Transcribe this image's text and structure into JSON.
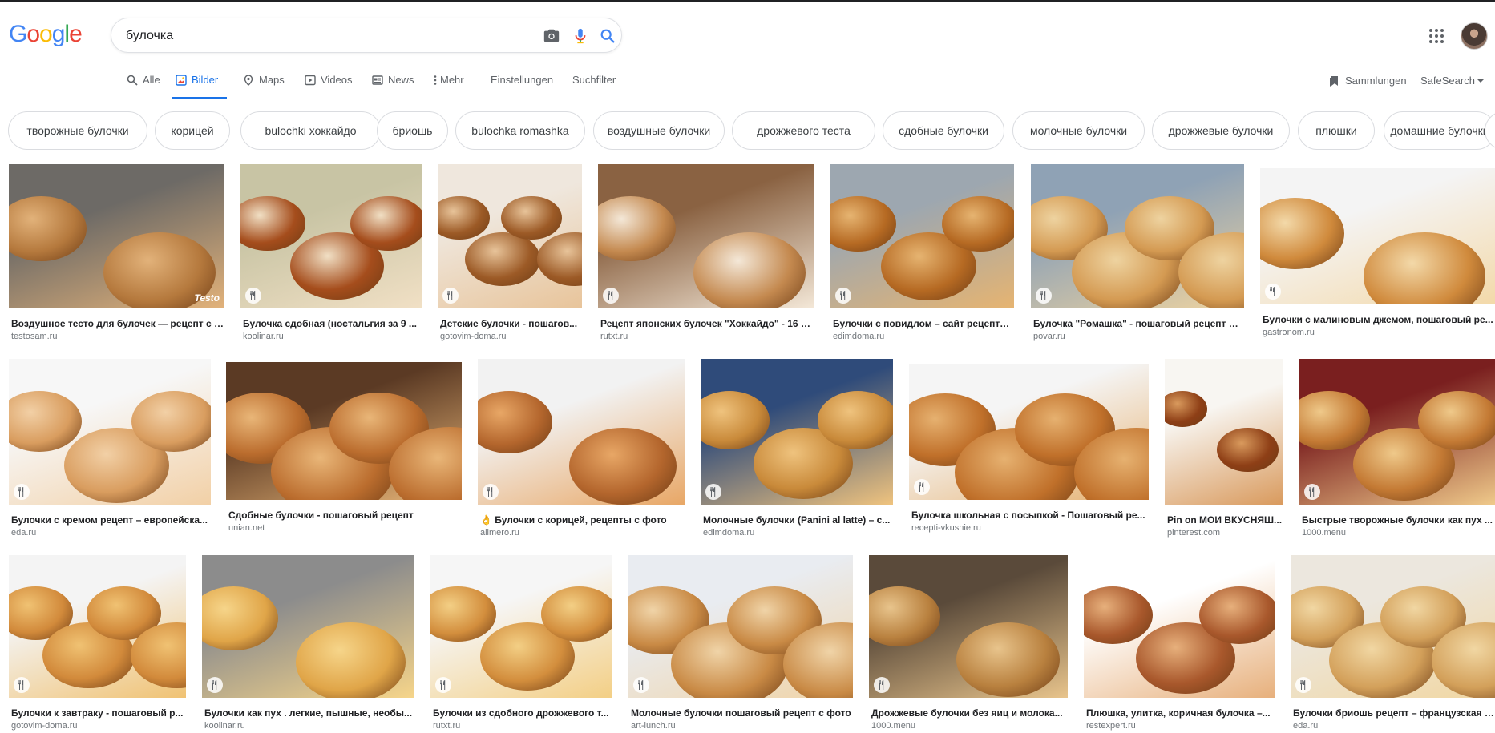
{
  "logo": {
    "letters": [
      "G",
      "o",
      "o",
      "g",
      "l",
      "e"
    ],
    "colors": [
      "#4285f4",
      "#ea4335",
      "#fbbc05",
      "#4285f4",
      "#34a853",
      "#ea4335"
    ]
  },
  "search": {
    "value": "булочка"
  },
  "icons": {
    "camera": "camera-icon",
    "mic": "mic-icon",
    "search": "search-icon",
    "apps": "apps-icon"
  },
  "nav": {
    "alle": "Alle",
    "bilder": "Bilder",
    "maps": "Maps",
    "videos": "Videos",
    "news": "News",
    "mehr": "Mehr",
    "einstellungen": "Einstellungen",
    "suchfilter": "Suchfilter",
    "sammlungen": "Sammlungen",
    "safesearch": "SafeSearch"
  },
  "accent": "#1a73e8",
  "chips": [
    "творожные булочки",
    "корицей",
    "bulochki хоккайдо",
    "бриошь",
    "bulochka romashka",
    "воздушные булочки",
    "дрожжевого теста",
    "сдобные булочки",
    "молочные булочки",
    "дрожжевые булочки",
    "плюшки",
    "домашние булочки"
  ],
  "results": [
    {
      "caption": "Воздушное тесто для булочек — рецепт с в...",
      "source": "testosam.ru",
      "watermark": "Testo",
      "recipe": false
    },
    {
      "caption": "Булочка сдобная (ностальгия за 9 ...",
      "source": "koolinar.ru",
      "recipe": true
    },
    {
      "caption": "Детские булочки - пошагов...",
      "source": "gotovim-doma.ru",
      "recipe": true
    },
    {
      "caption": "Рецепт японских булочек \"Хоккайдо\" - 16 п...",
      "source": "rutxt.ru",
      "recipe": true
    },
    {
      "caption": "Булочки с повидлом – сайт рецепто...",
      "source": "edimdoma.ru",
      "recipe": true
    },
    {
      "caption": "Булочка \"Ромашка\" - пошаговый рецепт с ...",
      "source": "povar.ru",
      "recipe": true
    },
    {
      "caption": "Булочки с малиновым джемом, пошаговый ре...",
      "source": "gastronom.ru",
      "recipe": true
    },
    {
      "caption": "Булочки с кремом рецепт – европейска...",
      "source": "eda.ru",
      "recipe": true
    },
    {
      "caption": "Сдобные булочки - пошаговый рецепт",
      "source": "unian.net",
      "recipe": false
    },
    {
      "caption": "👌 Булочки с корицей, рецепты с фото",
      "source": "alimero.ru",
      "recipe": true
    },
    {
      "caption": "Молочные булочки (Panini al latte) – с...",
      "source": "edimdoma.ru",
      "recipe": true
    },
    {
      "caption": "Булочка школьная с посыпкой - Пошаговый ре...",
      "source": "recepti-vkusnie.ru",
      "recipe": true
    },
    {
      "caption": "Pin on МОИ ВКУСНЯШ...",
      "source": "pinterest.com",
      "recipe": false
    },
    {
      "caption": "Быстрые творожные булочки как пух ...",
      "source": "1000.menu",
      "recipe": true
    },
    {
      "caption": "Булочки к завтраку - пошаговый р...",
      "source": "gotovim-doma.ru",
      "recipe": true
    },
    {
      "caption": "Булочки как пух . легкие, пышные, необы...",
      "source": "koolinar.ru",
      "recipe": true
    },
    {
      "caption": "Булочки из сдобного дрожжевого т...",
      "source": "rutxt.ru",
      "recipe": true
    },
    {
      "caption": "Молочные булочки пошаговый рецепт с фото",
      "source": "art-lunch.ru",
      "recipe": true
    },
    {
      "caption": "Дрожжевые булочки без яиц и молока...",
      "source": "1000.menu",
      "recipe": true
    },
    {
      "caption": "Плюшка, улитка, коричная булочка –...",
      "source": "restexpert.ru",
      "recipe": false
    },
    {
      "caption": "Булочки бриошь рецепт – французская к...",
      "source": "eda.ru",
      "recipe": true
    }
  ]
}
